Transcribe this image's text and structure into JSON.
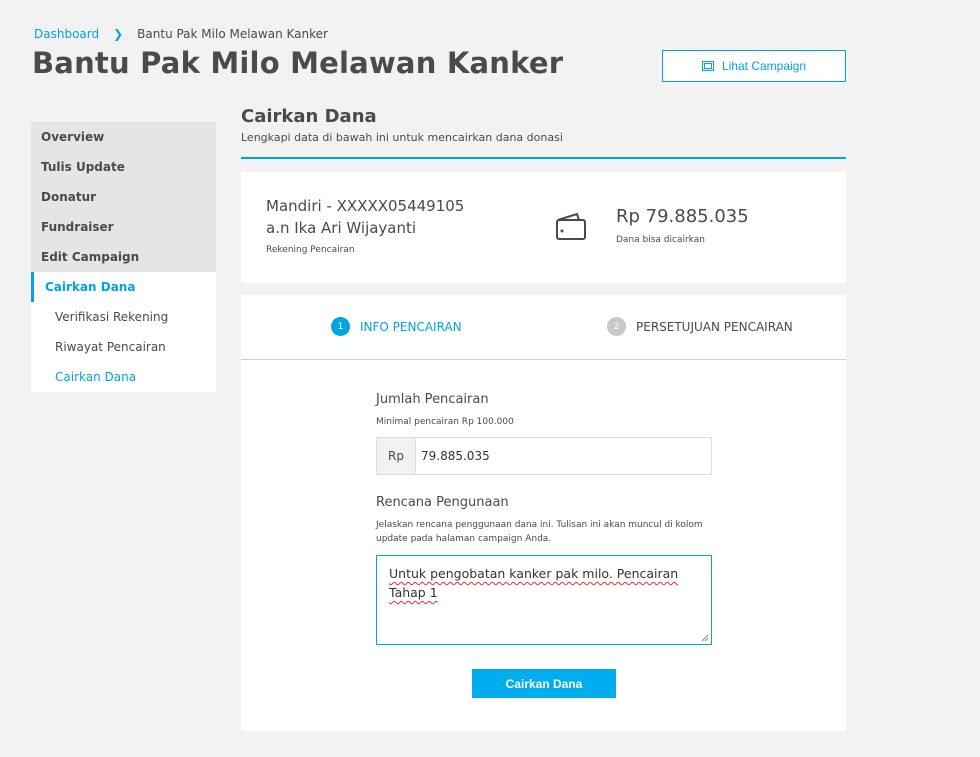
{
  "breadcrumb": {
    "home": "Dashboard",
    "separator": ">",
    "current": "Bantu Pak Milo Melawan Kanker"
  },
  "page_title": "Bantu Pak Milo Melawan Kanker",
  "lihat_button": {
    "label": "Lihat Campaign",
    "icon": "image-icon"
  },
  "sidebar": {
    "items": [
      {
        "label": "Overview"
      },
      {
        "label": "Tulis Update"
      },
      {
        "label": "Donatur"
      },
      {
        "label": "Fundraiser"
      },
      {
        "label": "Edit Campaign"
      },
      {
        "label": "Cairkan Dana",
        "active": true
      }
    ],
    "subitems": [
      {
        "label": "Verifikasi Rekening"
      },
      {
        "label": "Riwayat Pencairan"
      },
      {
        "label": "Cairkan Dana",
        "active": true
      }
    ]
  },
  "section": {
    "title": "Cairkan Dana",
    "subtitle": "Lengkapi data di bawah ini untuk mencairkan dana donasi"
  },
  "account": {
    "bank_line": "Mandiri - XXXXX05449105",
    "owner_line": "a.n Ika Ari Wijayanti",
    "caption": "Rekening Pencairan",
    "amount": "Rp 79.885.035",
    "amount_caption": "Dana bisa dicairkan"
  },
  "steps": [
    {
      "num": "1",
      "label": "INFO PENCAIRAN",
      "active": true
    },
    {
      "num": "2",
      "label": "PERSETUJUAN PENCAIRAN",
      "active": false
    }
  ],
  "form": {
    "amount_label": "Jumlah Pencairan",
    "amount_hint": "Minimal pencairan Rp 100.000",
    "amount_prefix": "Rp",
    "amount_value": "79.885.035",
    "plan_label": "Rencana Pengunaan",
    "plan_hint": "Jelaskan rencana penggunaan dana ini. Tulisan ini akan muncul di kolom update pada halaman campaign Anda.",
    "plan_value": "Untuk pengobatan kanker pak milo. Pencairan Tahap 1",
    "submit_label": "Cairkan Dana"
  },
  "colors": {
    "accent": "#00a4e4",
    "button": "#00aeef",
    "background": "#f2f2f2"
  }
}
